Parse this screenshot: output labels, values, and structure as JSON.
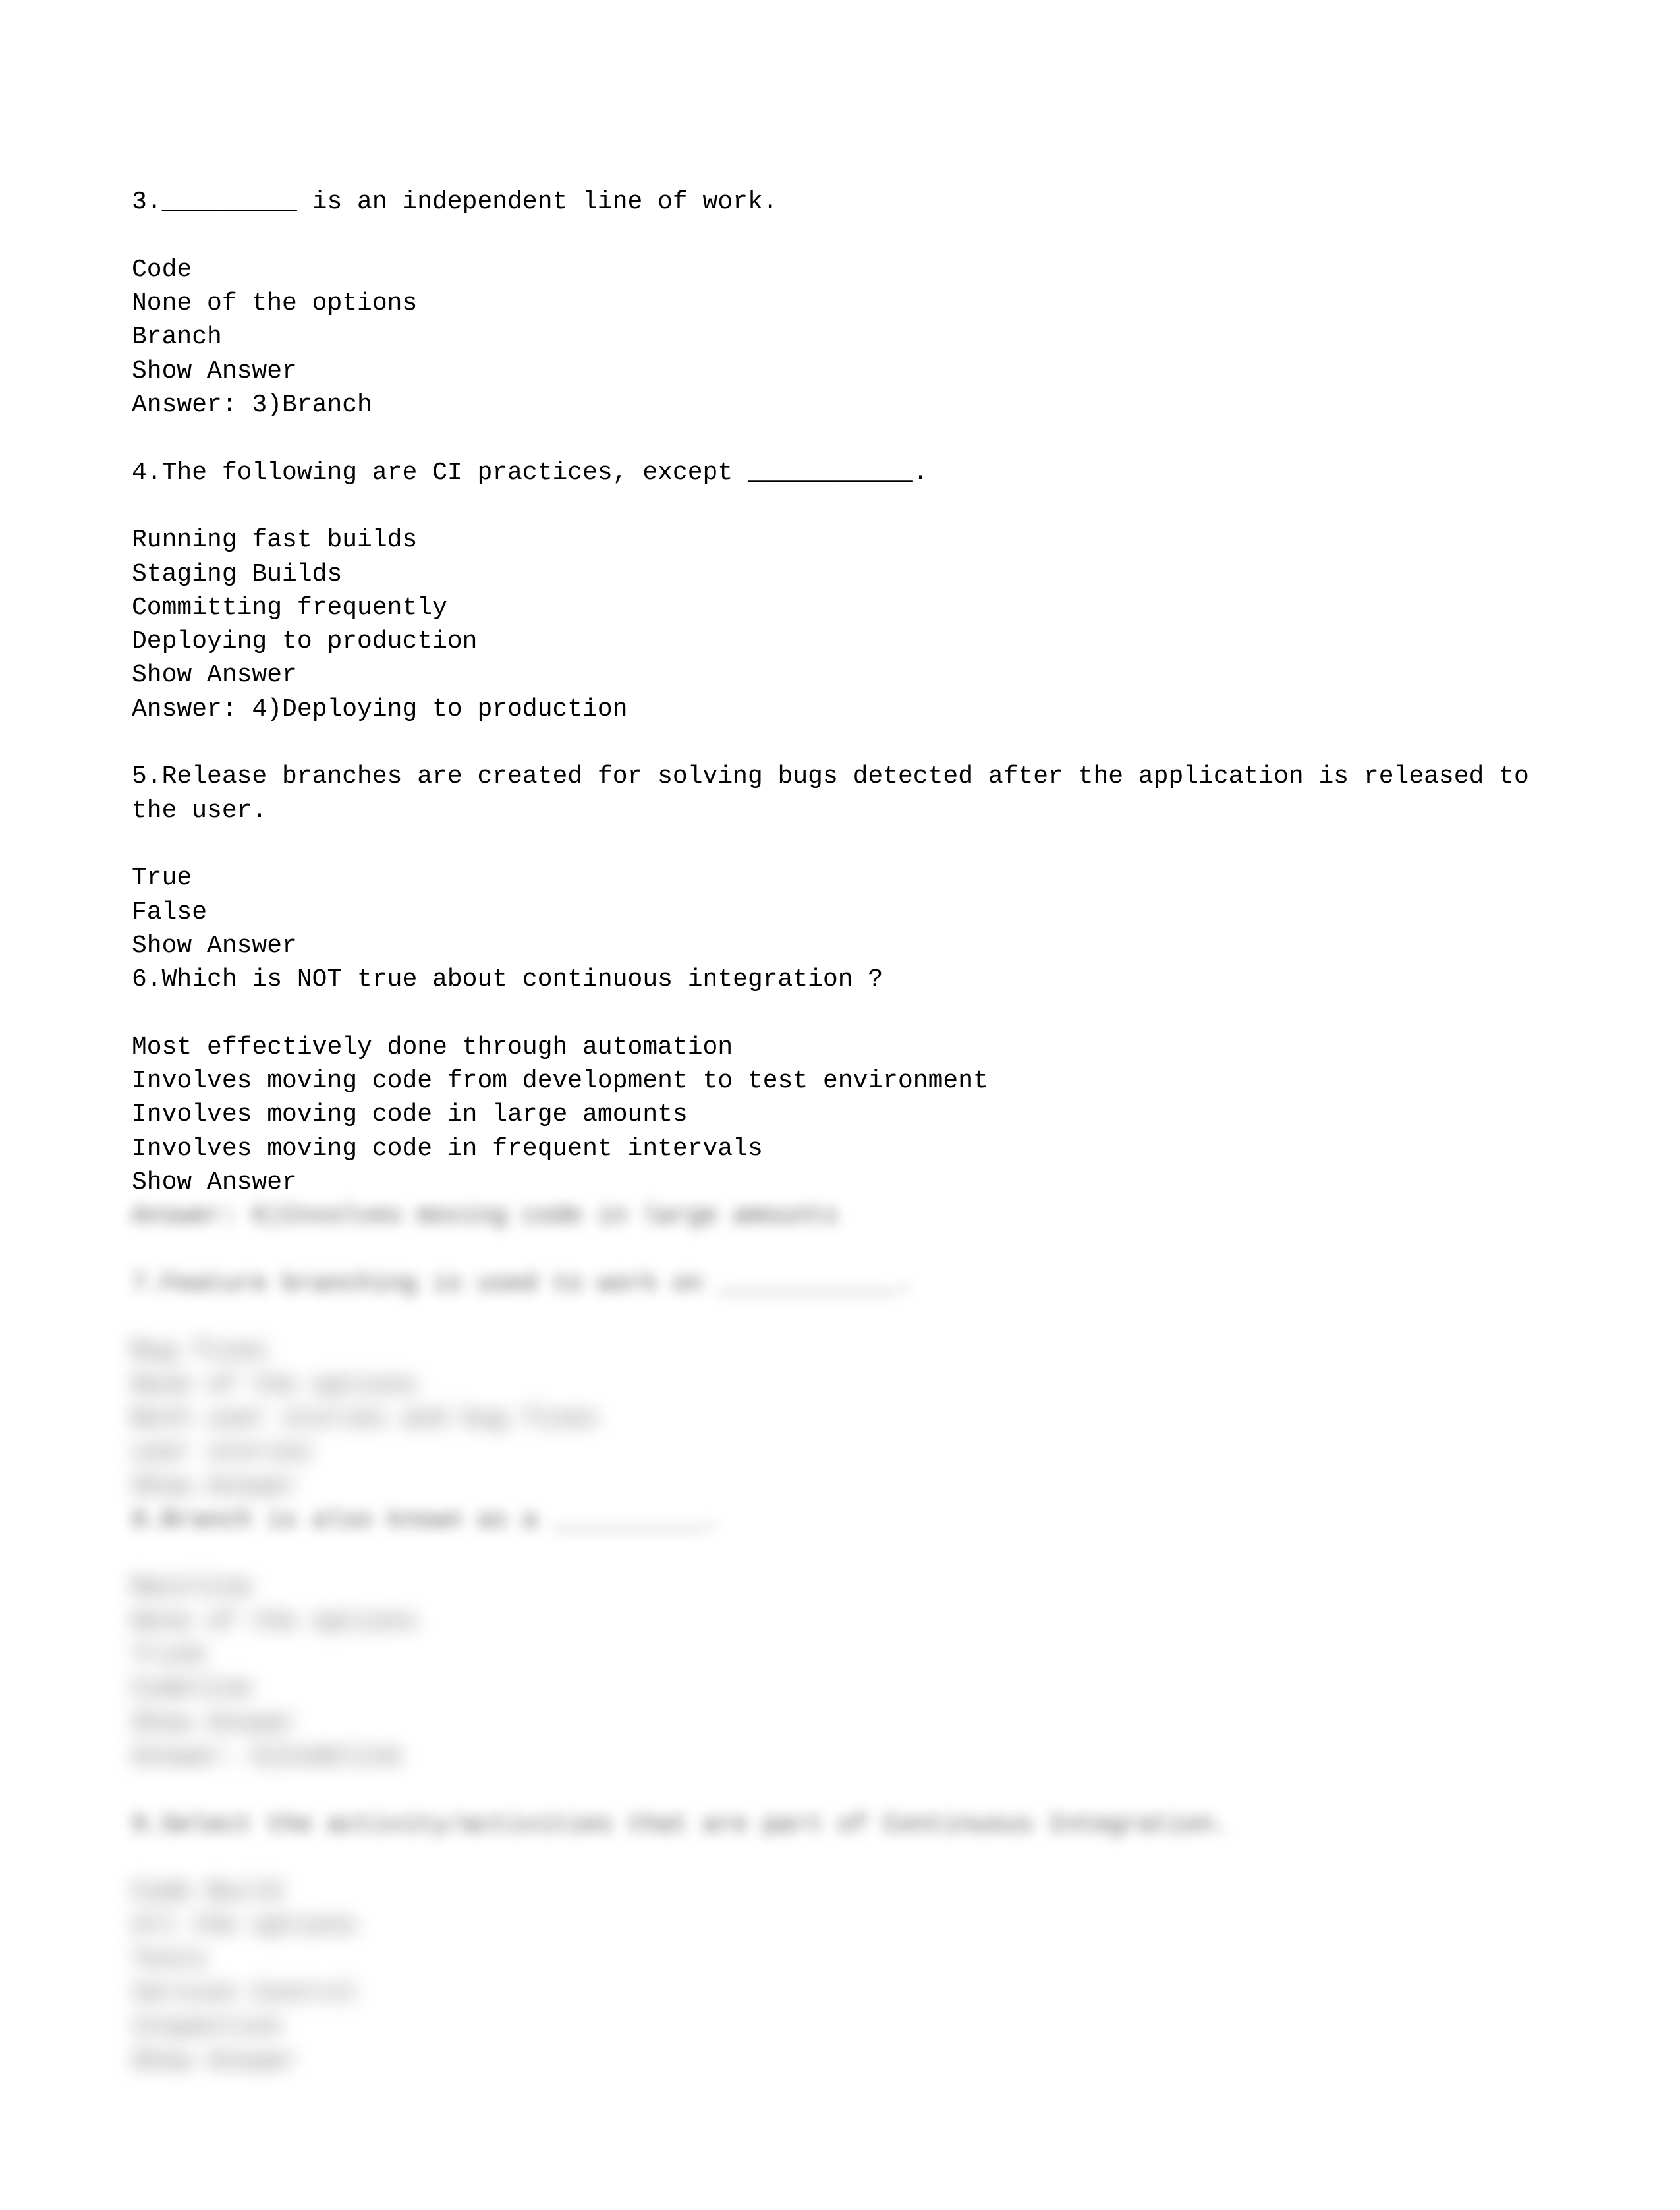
{
  "questions": [
    {
      "number": "3.",
      "text": "_________ is an independent line of work.",
      "options": [
        "Code",
        "None of the options",
        "Branch"
      ],
      "showAnswerLabel": "Show Answer",
      "answerLabel": "Answer: 3)Branch"
    },
    {
      "number": "4.",
      "text": "The following are CI practices, except ___________.",
      "options": [
        "Running fast builds",
        "Staging Builds",
        "Committing frequently",
        "Deploying to production"
      ],
      "showAnswerLabel": "Show Answer",
      "answerLabel": "Answer: 4)Deploying to production"
    },
    {
      "number": "5.",
      "text": "Release branches are created for solving bugs detected after the application is released to the user.",
      "options": [
        "True",
        "False"
      ],
      "showAnswerLabel": "Show Answer",
      "answerLabel": ""
    },
    {
      "number": "6.",
      "text": "Which is NOT true about continuous integration ?",
      "options": [
        "Most effectively done through automation",
        "Involves moving code from development to test environment",
        "Involves moving code in large amounts",
        "Involves moving code in frequent intervals"
      ],
      "showAnswerLabel": "Show Answer",
      "answerLabel": ""
    }
  ],
  "blurred": {
    "q6answer": "Answer: 6)Involves moving code in large amounts",
    "q7": {
      "header": "7.Feature branching is used to work on ____________.",
      "lines": [
        "Bug fixes",
        "None of the options",
        "Both user stories and bug fixes",
        "user stories",
        "Show Answer"
      ]
    },
    "q8": {
      "header": "8.Branch is also known as a __________.",
      "lines": [
        "Mainline",
        "None of the options",
        "Trunk",
        "Codeline",
        "Show Answer",
        "Answer: 8)Codeline"
      ]
    },
    "q9": {
      "header": "9.Select the activity/activities that are part of Continuous Integration.",
      "lines": [
        "Code Build",
        "All the options",
        "Tests",
        "Version Control",
        "Inspection",
        "Show Answer"
      ]
    }
  }
}
